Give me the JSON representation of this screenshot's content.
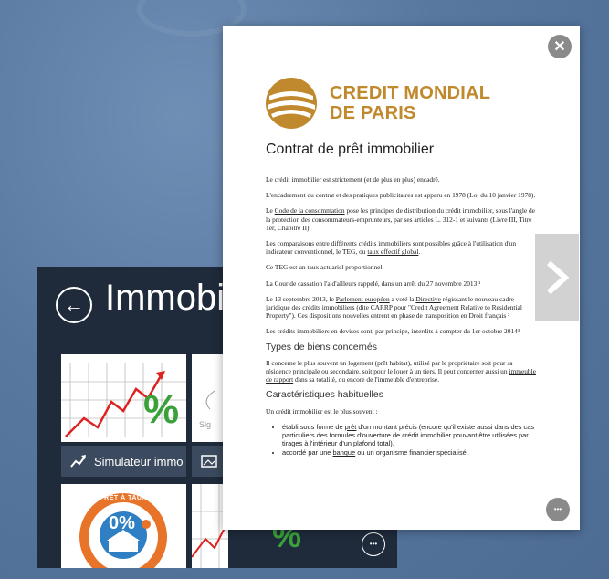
{
  "app": {
    "title": "Immobilier",
    "tiles": [
      {
        "label": "Simulateur immo",
        "icon": "chart-icon",
        "percent_sign": "%"
      },
      {
        "label": "",
        "icon": "image-icon"
      },
      {
        "badge_top": "PRÊT À TAUX ZÉRO",
        "badge_value": "0%"
      },
      {
        "percent_sign": "%"
      }
    ]
  },
  "document": {
    "brand_line1": "CREDIT MONDIAL",
    "brand_line2": "DE PARIS",
    "title": "Contrat de prêt immobilier",
    "paragraphs": {
      "p1": "Le crédit immobilier est strictement (et de plus en plus) encadré.",
      "p2": "L'encadrement du contrat et des pratiques publicitaires est apparu en 1978 (Loi du 10 janvier 1978).",
      "p3_link": "Code de la consommation",
      "p3_before": "Le ",
      "p3_after": " pose les principes de distribution du crédit immobilier, sous l'angle de la protection des consommateurs-emprunteurs, par ses articles L. 312-1 et suivants (Livre III, Titre 1er, Chapitre II).",
      "p4_before": "Les comparaisons entre différents crédits immobiliers sont possibles grâce à l'utilisation d'un indicateur conventionnel, le TEG, ou ",
      "p4_link": "taux effectif global",
      "p4_after": ".",
      "p5": "Ce TEG est un taux actuariel proportionnel.",
      "p6": "La Cour de cassation l'a d'ailleurs rappelé, dans un arrêt du 27 novembre 2013 ¹",
      "p7_a": "Le 13 septembre 2013, le ",
      "p7_link1": "Parlement européen",
      "p7_b": " a voté la ",
      "p7_link2": "Directive",
      "p7_c": " régissant le nouveau cadre juridique des crédits immobiliers (dite CARRP pour \"Credit Agreement Relative to Residential Property\"). Ces dispositions nouvelles entrent en phase de transposition en Droit français ²",
      "p8": "Les crédits immobiliers en devises sont, par principe, interdits à compter du 1er octobre 2014³"
    },
    "h_types": "Types de biens concernés",
    "p_types_before": "Il concerne le plus souvent un logement (prêt habitat), utilisé par le propriétaire soit pour sa résidence principale ou secondaire, soit pour le louer à un tiers. Il peut concerner aussi un ",
    "p_types_link": "immeuble de rapport",
    "p_types_after": " dans sa totalité, ou encore de l'immeuble d'entreprise.",
    "h_carac": "Caractéristiques habituelles",
    "p_carac": "Un crédit immobilier est le plus souvent :",
    "bullet1_a": "établi sous forme de ",
    "bullet1_link": "prêt",
    "bullet1_b": " d'un montant précis (encore qu'il existe aussi dans des cas particuliers des formules d'ouverture de crédit immobilier pouvant être utilisées par tirages à l'intérieur d'un plafond total).",
    "bullet2_a": "accordé par une ",
    "bullet2_link": "banque",
    "bullet2_b": " ou un organisme financier spécialisé."
  },
  "controls": {
    "close_glyph": "✕",
    "more_glyph": "•••",
    "next_glyph": "❯",
    "back_glyph": "←"
  },
  "colors": {
    "brand": "#c0892d",
    "app_bg": "#1f2b3b",
    "tile_label_bg": "#3b4a5e",
    "percent_green": "#3aa13a"
  }
}
